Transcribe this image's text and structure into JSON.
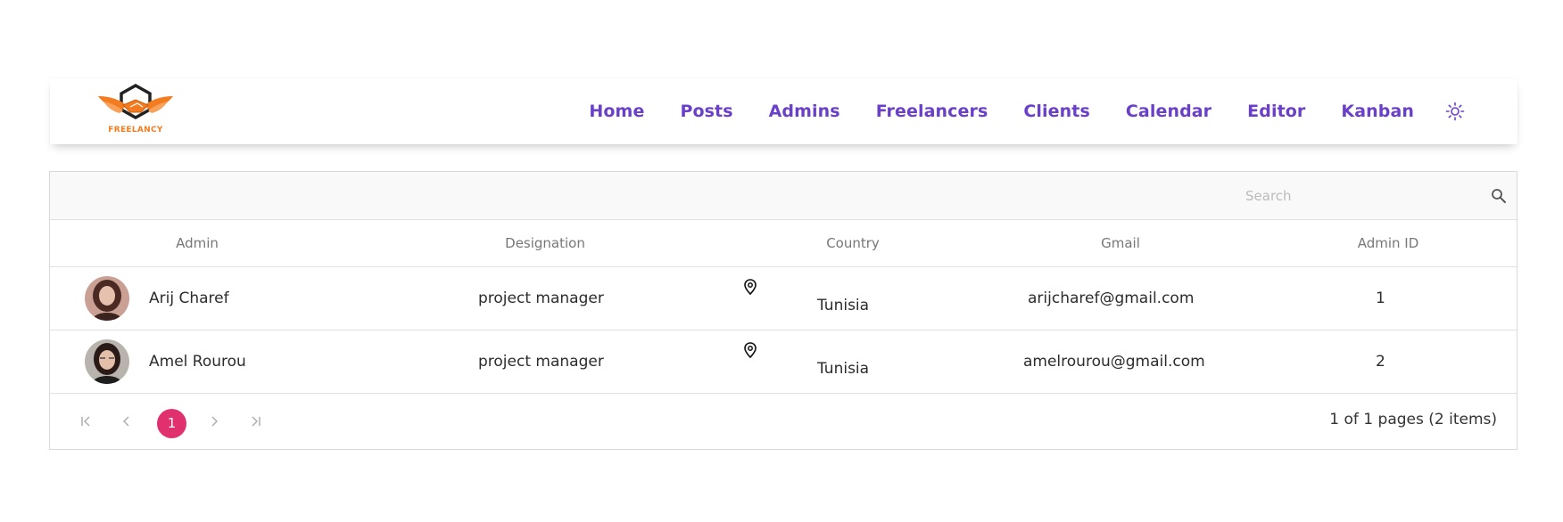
{
  "brand": {
    "logo_text": "FREELANCY",
    "accent": "#f47c20"
  },
  "nav": {
    "items": [
      "Home",
      "Posts",
      "Admins",
      "Freelancers",
      "Clients",
      "Calendar",
      "Editor",
      "Kanban"
    ],
    "color": "#6a3fc9",
    "theme_icon": "sun-icon"
  },
  "grid": {
    "search_placeholder": "Search",
    "columns": [
      "Admin",
      "Designation",
      "Country",
      "Gmail",
      "Admin ID"
    ],
    "rows": [
      {
        "name": "Arij Charef",
        "designation": "project manager",
        "country": "Tunisia",
        "gmail": "arijcharef@gmail.com",
        "id": "1"
      },
      {
        "name": "Amel Rourou",
        "designation": "project manager",
        "country": "Tunisia",
        "gmail": "amelrourou@gmail.com",
        "id": "2"
      }
    ],
    "pager": {
      "current_page": "1",
      "info": "1 of 1 pages (2 items)",
      "accent": "#e0306e"
    }
  }
}
